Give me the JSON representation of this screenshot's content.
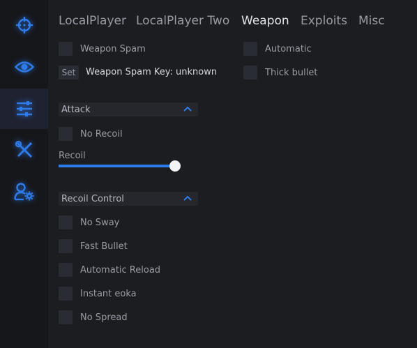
{
  "colors": {
    "background": "#1c1d21",
    "sidebar": "#16171b",
    "accent": "#2e7bea",
    "text_active": "#e3e4e8",
    "text_muted": "#9a9ca5",
    "control": "#2a2c33"
  },
  "sidebar": {
    "items": [
      {
        "icon": "crosshair-icon",
        "active": false
      },
      {
        "icon": "eye-icon",
        "active": false
      },
      {
        "icon": "sliders-icon",
        "active": true
      },
      {
        "icon": "tools-icon",
        "active": false
      },
      {
        "icon": "user-settings-icon",
        "active": false
      }
    ]
  },
  "tabs": [
    {
      "label": "LocalPlayer"
    },
    {
      "label": "LocalPlayer Two"
    },
    {
      "label": "Weapon"
    },
    {
      "label": "Exploits"
    },
    {
      "label": "Misc"
    }
  ],
  "active_tab": "Weapon",
  "weapon": {
    "weapon_spam": {
      "label": "Weapon Spam",
      "checked": false
    },
    "automatic": {
      "label": "Automatic",
      "checked": false
    },
    "set_button": "Set",
    "spam_key_label": "Weapon Spam Key: unknown",
    "thick_bullet": {
      "label": "Thick bullet",
      "checked": false
    }
  },
  "attack": {
    "title": "Attack",
    "no_recoil": {
      "label": "No Recoil",
      "checked": false
    },
    "recoil_slider": {
      "label": "Recoil",
      "value_fraction": 1.0
    }
  },
  "recoil_control": {
    "title": "Recoil Control",
    "items": [
      {
        "label": "No Sway",
        "checked": false
      },
      {
        "label": "Fast Bullet",
        "checked": false
      },
      {
        "label": "Automatic Reload",
        "checked": false
      },
      {
        "label": "Instant eoka",
        "checked": false
      },
      {
        "label": "No Spread",
        "checked": false
      }
    ]
  }
}
